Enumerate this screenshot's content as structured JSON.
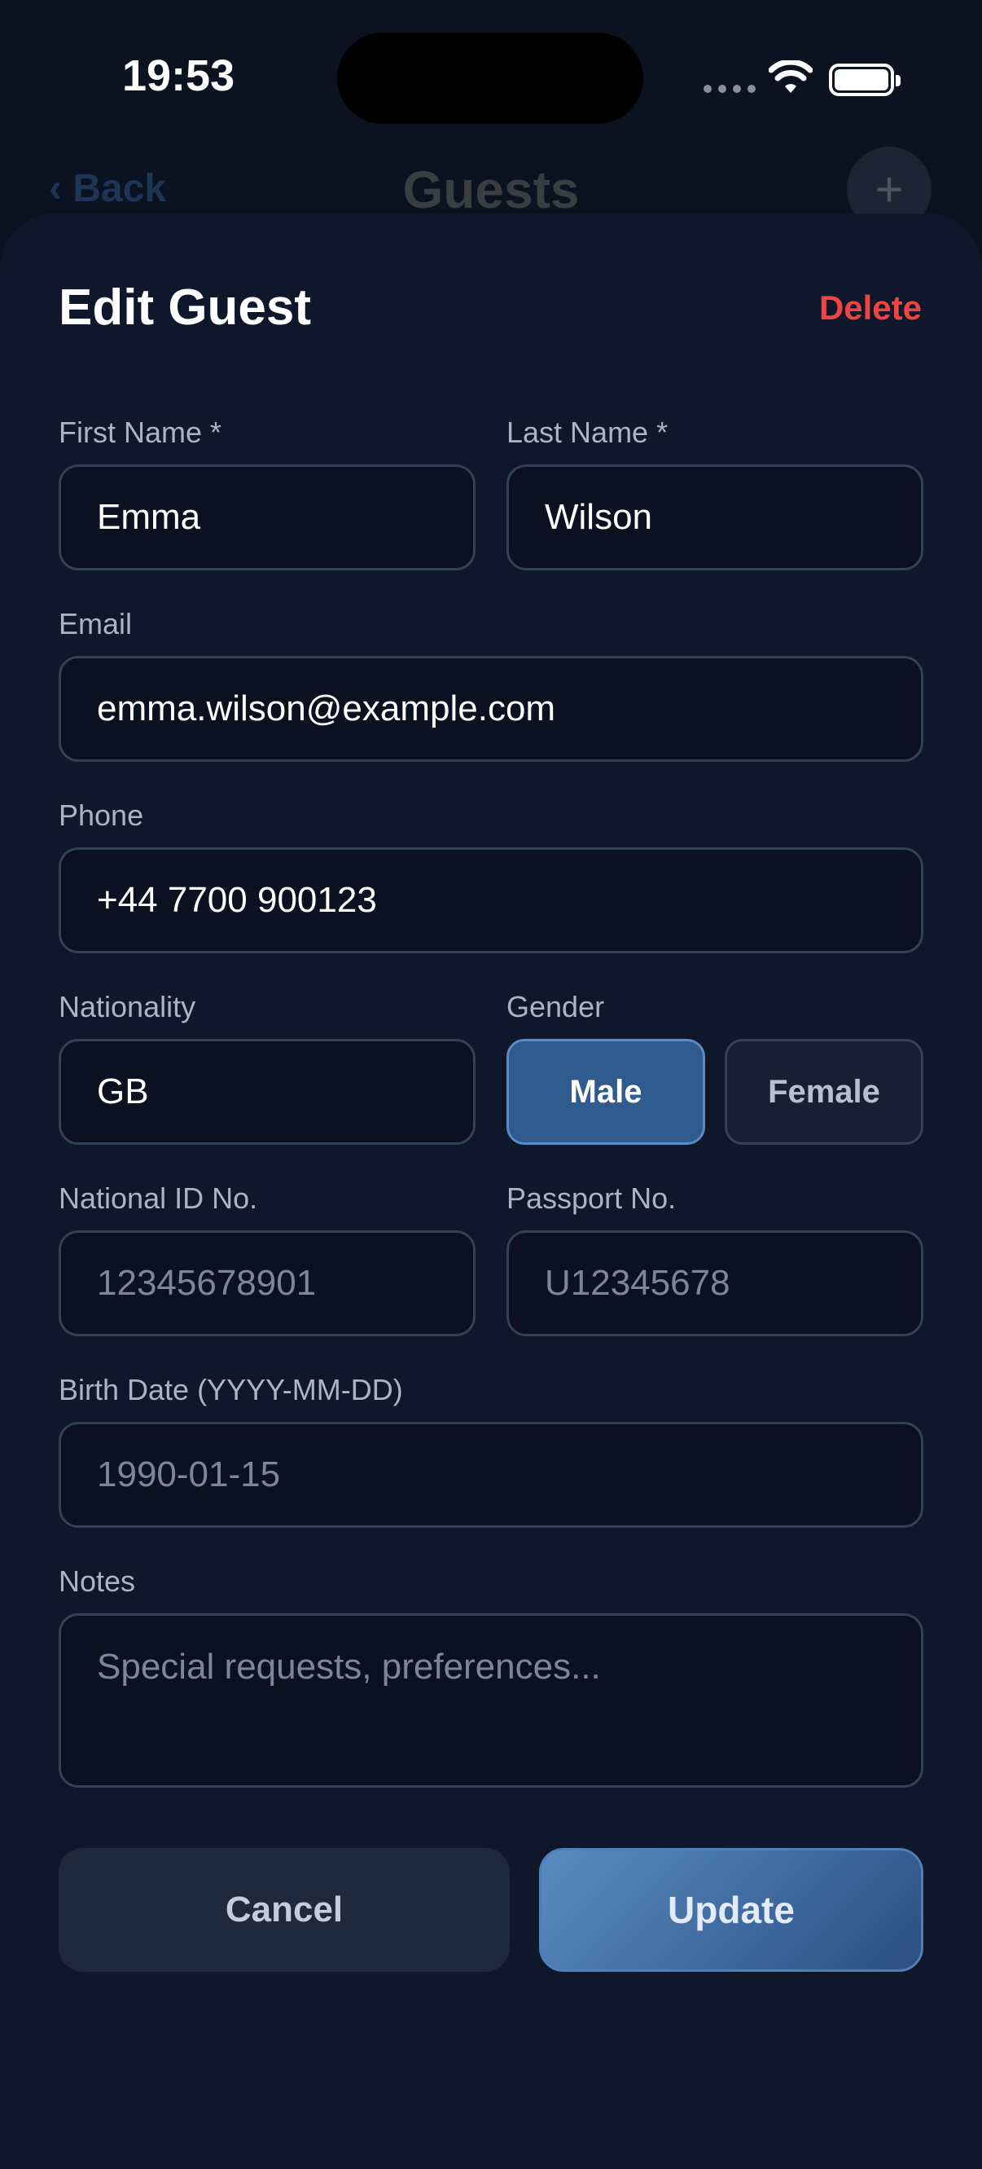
{
  "status_bar": {
    "time": "19:53"
  },
  "background_nav": {
    "back_label": "‹ Back",
    "title": "Guests",
    "add_label": "+"
  },
  "sheet": {
    "title": "Edit Guest",
    "delete_label": "Delete"
  },
  "form": {
    "first_name": {
      "label": "First Name *",
      "value": "Emma"
    },
    "last_name": {
      "label": "Last Name *",
      "value": "Wilson"
    },
    "email": {
      "label": "Email",
      "value": "emma.wilson@example.com"
    },
    "phone": {
      "label": "Phone",
      "value": "+44 7700 900123"
    },
    "nationality": {
      "label": "Nationality",
      "value": "GB"
    },
    "gender": {
      "label": "Gender",
      "options": [
        "Male",
        "Female"
      ],
      "selected": "Male"
    },
    "national_id": {
      "label": "National ID No.",
      "placeholder": "12345678901"
    },
    "passport": {
      "label": "Passport No.",
      "placeholder": "U12345678"
    },
    "birth_date": {
      "label": "Birth Date (YYYY-MM-DD)",
      "placeholder": "1990-01-15"
    },
    "notes": {
      "label": "Notes",
      "placeholder": "Special requests, preferences..."
    }
  },
  "actions": {
    "cancel_label": "Cancel",
    "update_label": "Update"
  },
  "colors": {
    "accent": "#2f5b8e",
    "danger": "#ef4444",
    "sheet_bg": "#0f172a",
    "field_bg": "#0b1120"
  }
}
